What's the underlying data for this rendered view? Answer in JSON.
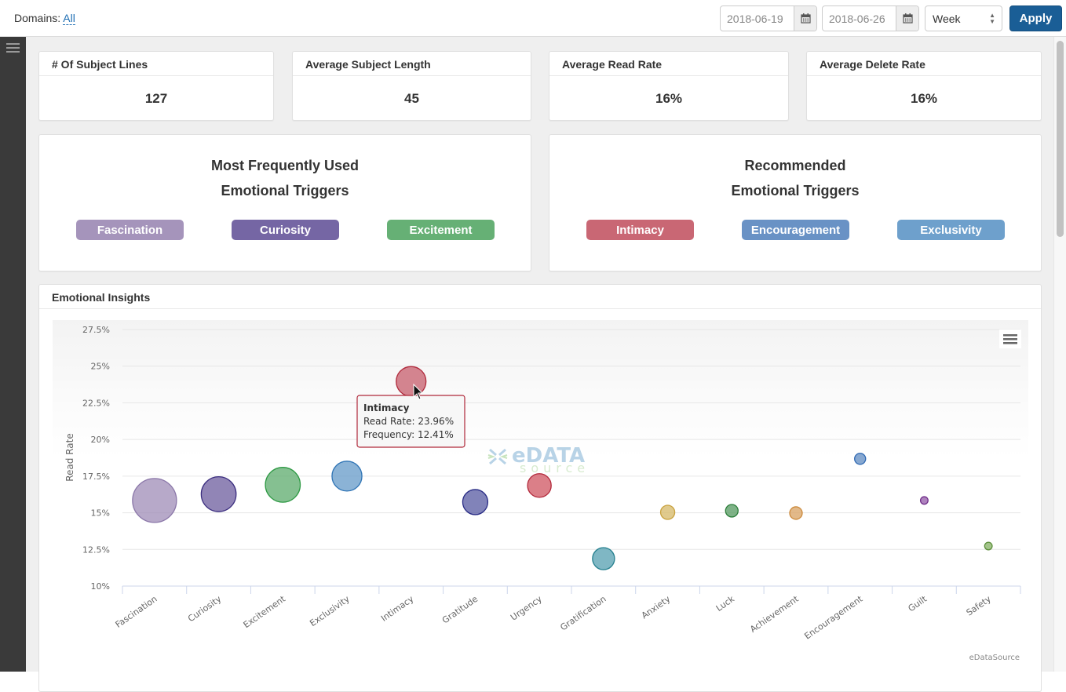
{
  "topbar": {
    "domains_label": "Domains:",
    "domains_value": "All",
    "start_date": "2018-06-19",
    "end_date": "2018-06-26",
    "period": "Week",
    "apply_label": "Apply"
  },
  "stats": [
    {
      "label": "# Of Subject Lines",
      "value": "127"
    },
    {
      "label": "Average Subject Length",
      "value": "45"
    },
    {
      "label": "Average Read Rate",
      "value": "16%"
    },
    {
      "label": "Average Delete Rate",
      "value": "16%"
    }
  ],
  "most_used": {
    "title_line1": "Most Frequently Used",
    "title_line2": "Emotional Triggers",
    "triggers": [
      {
        "label": "Fascination",
        "color": "#a594bb"
      },
      {
        "label": "Curiosity",
        "color": "#7566a4"
      },
      {
        "label": "Excitement",
        "color": "#66b075"
      }
    ]
  },
  "recommended": {
    "title_line1": "Recommended",
    "title_line2": "Emotional Triggers",
    "triggers": [
      {
        "label": "Intimacy",
        "color": "#c96774"
      },
      {
        "label": "Encouragement",
        "color": "#6992c5"
      },
      {
        "label": "Exclusivity",
        "color": "#6ea0cc"
      }
    ]
  },
  "insights": {
    "title": "Emotional Insights",
    "credit": "eDataSource",
    "watermark_top": "eDATA",
    "watermark_bottom": "source"
  },
  "chart_data": {
    "type": "scatter",
    "subtype": "bubble",
    "title": "Emotional Insights",
    "xlabel": "",
    "ylabel": "Read Rate",
    "ylim": [
      10,
      27.5
    ],
    "yticks": [
      "10%",
      "12.5%",
      "15%",
      "17.5%",
      "20%",
      "22.5%",
      "25%",
      "27.5%"
    ],
    "ytick_values": [
      10,
      12.5,
      15,
      17.5,
      20,
      22.5,
      25,
      27.5
    ],
    "grid": true,
    "legend": "none",
    "categories": [
      "Fascination",
      "Curiosity",
      "Excitement",
      "Exclusivity",
      "Intimacy",
      "Gratitude",
      "Urgency",
      "Gratification",
      "Anxiety",
      "Luck",
      "Achievement",
      "Encouragement",
      "Guilt",
      "Safety"
    ],
    "series": [
      {
        "name": "Fascination",
        "read_rate": 15.84,
        "frequency": 27.0,
        "color": "#a594bb",
        "stroke": "#8a76a8"
      },
      {
        "name": "Curiosity",
        "read_rate": 16.27,
        "frequency": 17.0,
        "color": "#7566a4",
        "stroke": "#3c2f80"
      },
      {
        "name": "Excitement",
        "read_rate": 16.91,
        "frequency": 17.0,
        "color": "#66b075",
        "stroke": "#2f9a45"
      },
      {
        "name": "Exclusivity",
        "read_rate": 17.5,
        "frequency": 12.5,
        "color": "#6ea0cc",
        "stroke": "#2f74b5"
      },
      {
        "name": "Intimacy",
        "read_rate": 23.96,
        "frequency": 12.41,
        "color": "#c96774",
        "stroke": "#b02a3c"
      },
      {
        "name": "Gratitude",
        "read_rate": 15.73,
        "frequency": 8.8,
        "color": "#6264a8",
        "stroke": "#2a2d86"
      },
      {
        "name": "Urgency",
        "read_rate": 16.86,
        "frequency": 7.8,
        "color": "#d25f6a",
        "stroke": "#b2283a"
      },
      {
        "name": "Gratification",
        "read_rate": 11.87,
        "frequency": 6.8,
        "color": "#5fa5b5",
        "stroke": "#26808f"
      },
      {
        "name": "Anxiety",
        "read_rate": 15.03,
        "frequency": 2.8,
        "color": "#d8bd70",
        "stroke": "#c9a23e"
      },
      {
        "name": "Luck",
        "read_rate": 15.14,
        "frequency": 2.2,
        "color": "#5e9f69",
        "stroke": "#2c7e3a"
      },
      {
        "name": "Achievement",
        "read_rate": 14.98,
        "frequency": 2.2,
        "color": "#dba86c",
        "stroke": "#cc8a3c"
      },
      {
        "name": "Encouragement",
        "read_rate": 18.68,
        "frequency": 1.7,
        "color": "#6992c5",
        "stroke": "#2e68b2"
      },
      {
        "name": "Guilt",
        "read_rate": 15.84,
        "frequency": 0.8,
        "color": "#9a63ae",
        "stroke": "#6f2d88"
      },
      {
        "name": "Safety",
        "read_rate": 12.73,
        "frequency": 0.8,
        "color": "#8cb56d",
        "stroke": "#5c8f3b"
      }
    ],
    "tooltip": {
      "title": "Intimacy",
      "line1": "Read Rate: 23.96%",
      "line2": "Frequency: 12.41%",
      "border_color": "#b0283a"
    }
  }
}
